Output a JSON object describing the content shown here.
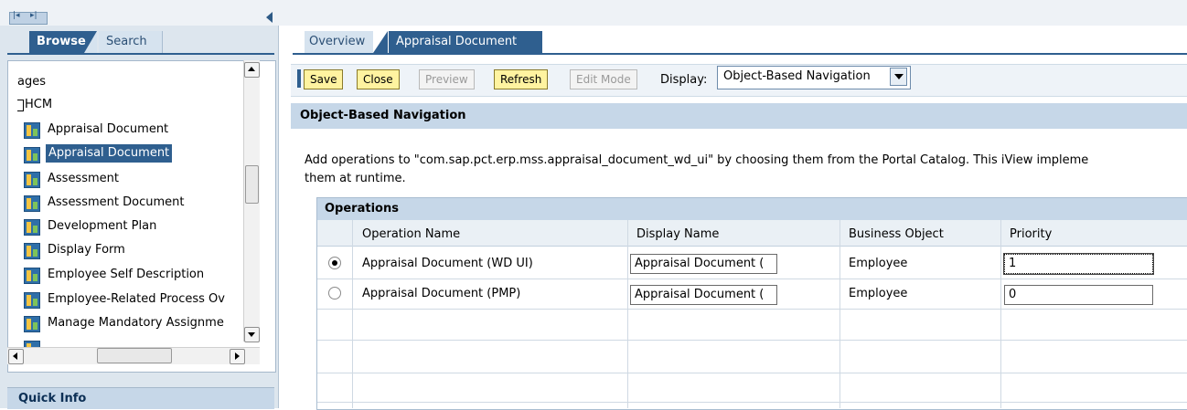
{
  "left_panel": {
    "tabs": {
      "browse": "Browse",
      "search": "Search"
    },
    "tree": {
      "partial_label": "ages",
      "folder": "HCM",
      "items": [
        "Appraisal Document",
        "Appraisal Document",
        "Assessment",
        "Assessment Document",
        "Development Plan",
        "Display Form",
        "Employee Self Description",
        "Employee-Related Process Ov",
        "Manage Mandatory Assignme"
      ],
      "selected_index": 1
    },
    "quick_info": "Quick Info"
  },
  "right_panel": {
    "tabs": {
      "overview": "Overview",
      "appraisal": "Appraisal Document"
    },
    "toolbar": {
      "save": "Save",
      "close": "Close",
      "preview": "Preview",
      "refresh": "Refresh",
      "edit_mode": "Edit Mode",
      "display_label": "Display:",
      "display_value": "Object-Based Navigation"
    },
    "section_title": "Object-Based Navigation",
    "description_line1": "Add operations to \"com.sap.pct.erp.mss.appraisal_document_wd_ui\" by choosing them from the Portal Catalog.  This iView impleme",
    "description_line2": "them at runtime.",
    "operations": {
      "title": "Operations",
      "columns": [
        "Operation Name",
        "Display Name",
        "Business Object",
        "Priority"
      ],
      "rows": [
        {
          "selected": true,
          "operation": "Appraisal Document (WD UI)",
          "display": "Appraisal Document (",
          "object": "Employee",
          "priority": "1"
        },
        {
          "selected": false,
          "operation": "Appraisal Document (PMP)",
          "display": "Appraisal Document (",
          "object": "Employee",
          "priority": "0"
        }
      ]
    }
  },
  "colors": {
    "accent": "#2f5f8f",
    "section_bg": "#c6d7e8",
    "button_active": "#fff3a0"
  }
}
